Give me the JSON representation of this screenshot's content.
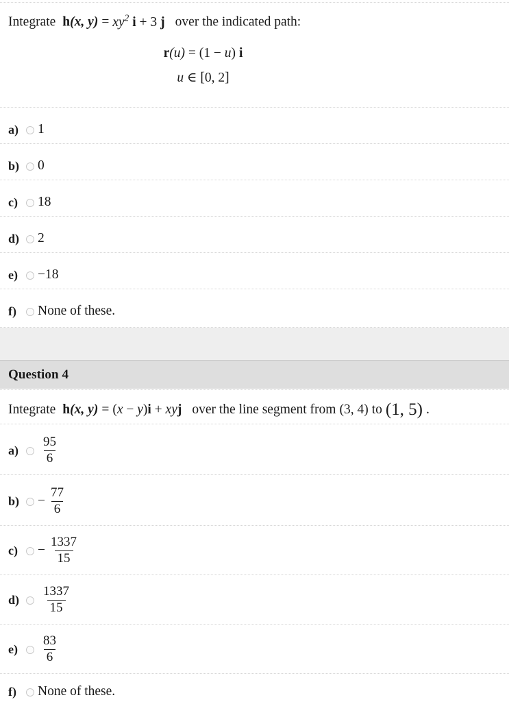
{
  "quiz": {
    "questions": [
      {
        "id": "q3",
        "header_visible": false,
        "stem_intro": "Integrate",
        "stem_function_lhs": "h(x, y)",
        "stem_equals": "=",
        "stem_function_rhs": "xy2 i + 3 j",
        "stem_tail": "over the indicated path:",
        "display_line_1": "r(u) = (1 − u) i",
        "display_line_2": "u ∈ [0, 2]",
        "options": [
          {
            "letter": "a)",
            "value": "1",
            "kind": "plain"
          },
          {
            "letter": "b)",
            "value": "0",
            "kind": "plain"
          },
          {
            "letter": "c)",
            "value": "18",
            "kind": "plain"
          },
          {
            "letter": "d)",
            "value": "2",
            "kind": "plain"
          },
          {
            "letter": "e)",
            "value": "−18",
            "kind": "plain"
          },
          {
            "letter": "f)",
            "value": "None of these.",
            "kind": "plain"
          }
        ]
      },
      {
        "id": "q4",
        "header_visible": true,
        "header_title": "Question 4",
        "stem_intro": "Integrate",
        "stem_function_lhs": "h(x, y)",
        "stem_equals": "=",
        "stem_function_rhs": "(x − y) i + xy j",
        "stem_tail": "over the line segment from",
        "point_from": "(3, 4)",
        "stem_to": "to",
        "point_to": "(1, 5)",
        "stem_period": ".",
        "options": [
          {
            "letter": "a)",
            "kind": "fraction",
            "sign": "",
            "numerator": "95",
            "denominator": "6"
          },
          {
            "letter": "b)",
            "kind": "fraction",
            "sign": "−",
            "numerator": "77",
            "denominator": "6"
          },
          {
            "letter": "c)",
            "kind": "fraction",
            "sign": "−",
            "numerator": "1337",
            "denominator": "15"
          },
          {
            "letter": "d)",
            "kind": "fraction",
            "sign": "",
            "numerator": "1337",
            "denominator": "15"
          },
          {
            "letter": "e)",
            "kind": "fraction",
            "sign": "",
            "numerator": "83",
            "denominator": "6"
          },
          {
            "letter": "f)",
            "kind": "plain",
            "value": "None of these."
          }
        ]
      }
    ]
  },
  "colors": {
    "page_background": "#ffffff",
    "text": "#1a1a1a",
    "rule": "#d6d6d6",
    "gap_band": "#eeeeee",
    "question_header_band": "#dedede",
    "radio_border": "#c9c9c9"
  }
}
